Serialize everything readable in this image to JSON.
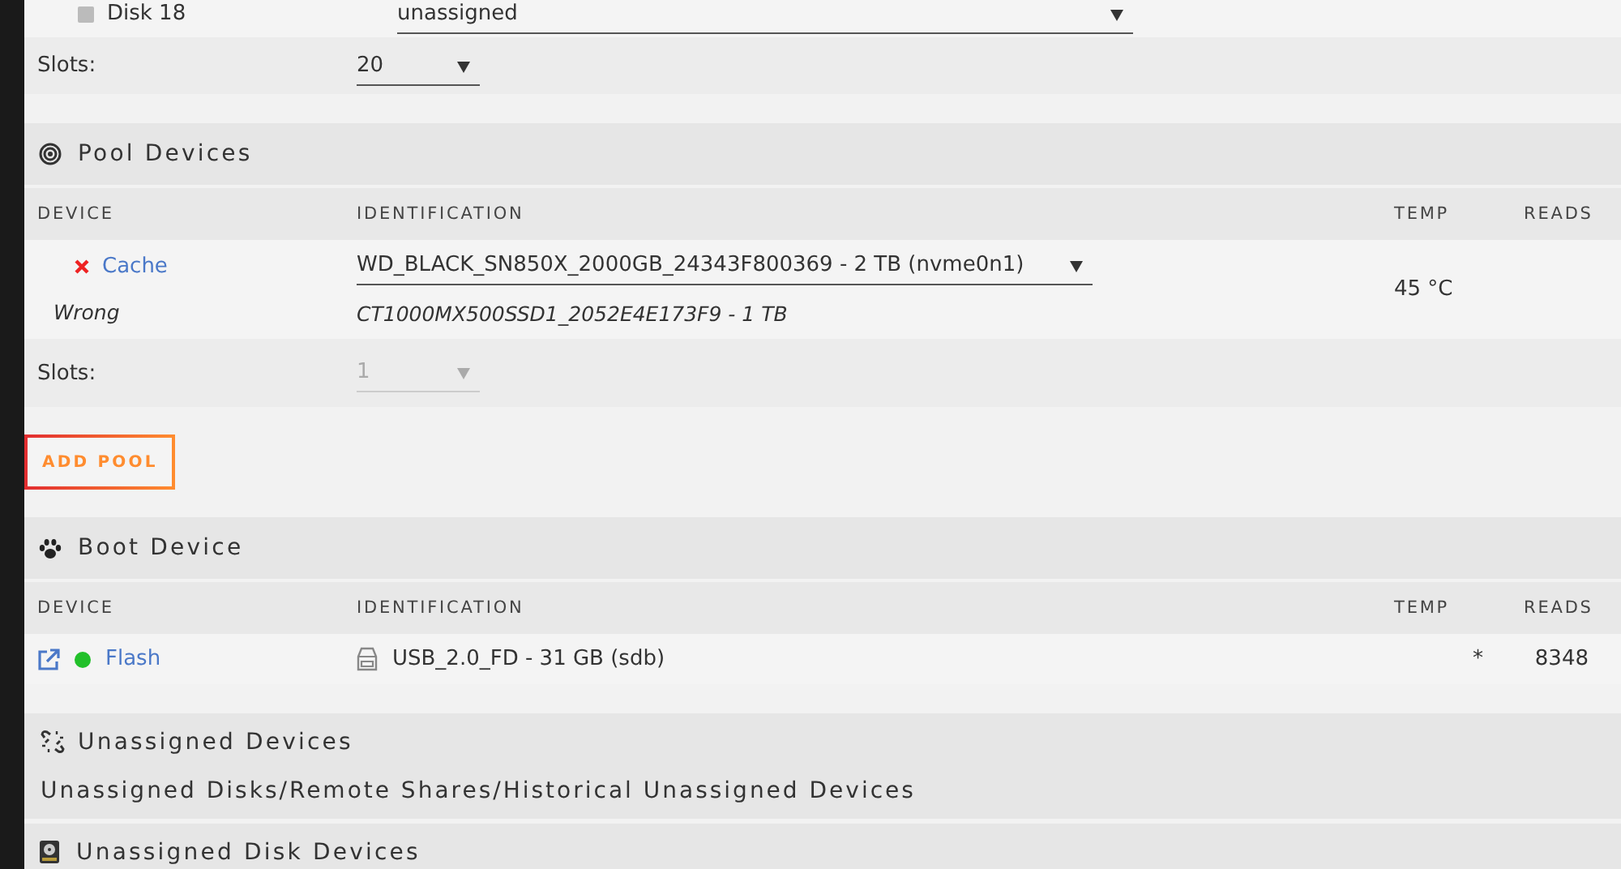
{
  "array": {
    "disk": {
      "name": "Disk 18",
      "checked": false,
      "assignment": "unassigned"
    },
    "slots": {
      "label": "Slots:",
      "value": "20",
      "disabled": false
    }
  },
  "pool_devices": {
    "title": "Pool Devices",
    "columns": [
      "DEVICE",
      "IDENTIFICATION",
      "TEMP",
      "READS"
    ],
    "device": {
      "error": true,
      "name": "Cache",
      "identification": "WD_BLACK_SN850X_2000GB_24343F800369 - 2 TB (nvme0n1)",
      "temp": "45 °C",
      "note_label": "Wrong",
      "note_value": "CT1000MX500SSD1_2052E4E173F9 - 1 TB"
    },
    "slots": {
      "label": "Slots:",
      "value": "1",
      "disabled": true
    },
    "add_button": "ADD POOL"
  },
  "boot_device": {
    "title": "Boot Device",
    "columns": [
      "DEVICE",
      "IDENTIFICATION",
      "TEMP",
      "READS"
    ],
    "device": {
      "online": true,
      "name": "Flash",
      "identification": "USB_2.0_FD - 31 GB (sdb)",
      "temp": "*",
      "reads": "8348"
    }
  },
  "unassigned_devices": {
    "title": "Unassigned Devices",
    "subtitle": "Unassigned Disks/Remote Shares/Historical Unassigned Devices"
  },
  "unassigned_disk_devices": {
    "title": "Unassigned Disk Devices"
  }
}
